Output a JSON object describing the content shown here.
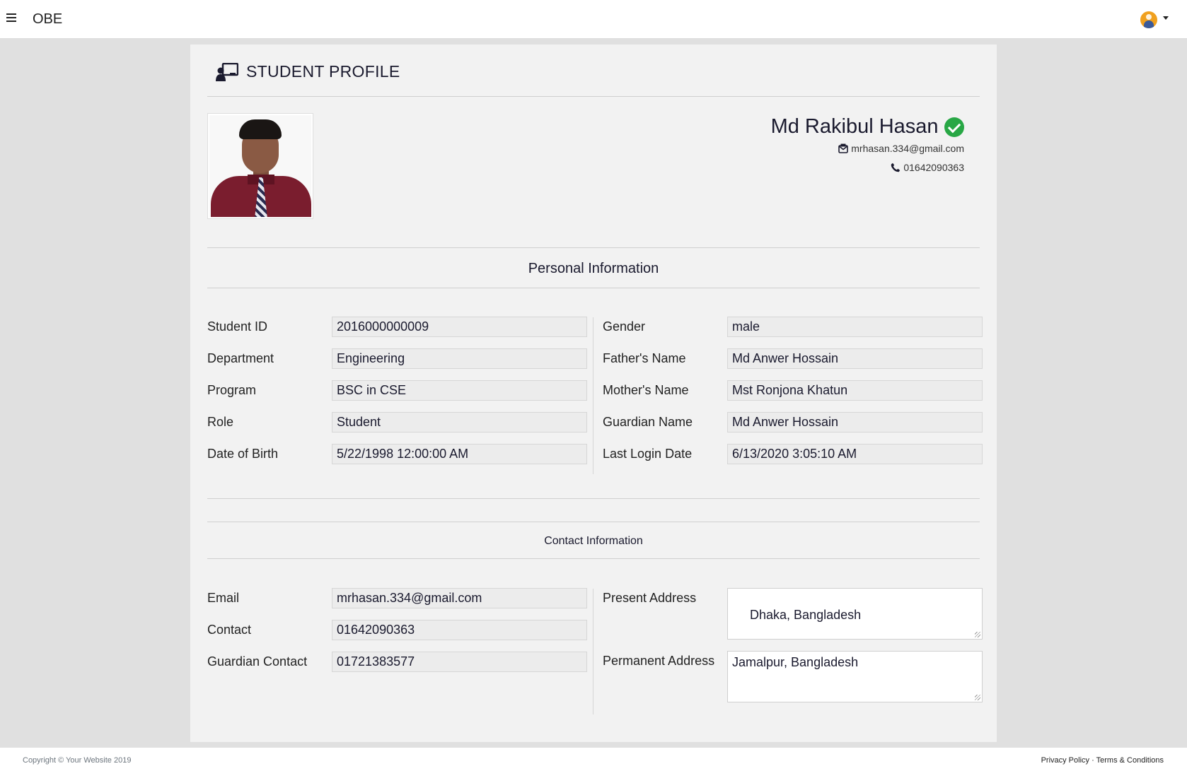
{
  "navbar": {
    "brand": "OBE",
    "menu_icon": "hamburger-icon",
    "user_icon": "user-avatar-icon"
  },
  "page": {
    "title": "STUDENT PROFILE",
    "title_icon": "user-chalkboard-icon"
  },
  "profile": {
    "name": "Md Rakibul Hasan",
    "email": "mrhasan.334@gmail.com",
    "phone": "01642090363",
    "verified_color": "#28a745"
  },
  "personal": {
    "title": "Personal Information",
    "left": [
      {
        "label": "Student ID",
        "value": "2016000000009"
      },
      {
        "label": "Department",
        "value": "Engineering"
      },
      {
        "label": "Program",
        "value": "BSC in CSE"
      },
      {
        "label": "Role",
        "value": "Student"
      },
      {
        "label": "Date of Birth",
        "value": "5/22/1998 12:00:00 AM"
      }
    ],
    "right": [
      {
        "label": "Gender",
        "value": "male"
      },
      {
        "label": "Father's Name",
        "value": "Md Anwer Hossain"
      },
      {
        "label": "Mother's Name",
        "value": "Mst Ronjona Khatun"
      },
      {
        "label": "Guardian Name",
        "value": "Md Anwer Hossain"
      },
      {
        "label": "Last Login Date",
        "value": "6/13/2020 3:05:10 AM"
      }
    ]
  },
  "contact": {
    "title": "Contact Information",
    "left": [
      {
        "label": "Email",
        "value": "mrhasan.334@gmail.com"
      },
      {
        "label": "Contact",
        "value": "01642090363"
      },
      {
        "label": "Guardian Contact",
        "value": "01721383577"
      }
    ],
    "right": [
      {
        "label": "Present Address",
        "value": " Dhaka, Bangladesh"
      },
      {
        "label": "Permanent Address",
        "value": "Jamalpur, Bangladesh"
      }
    ]
  },
  "footer": {
    "copyright": "Copyright © Your Website 2019",
    "privacy": "Privacy Policy",
    "separator": "·",
    "terms": "Terms & Conditions"
  }
}
